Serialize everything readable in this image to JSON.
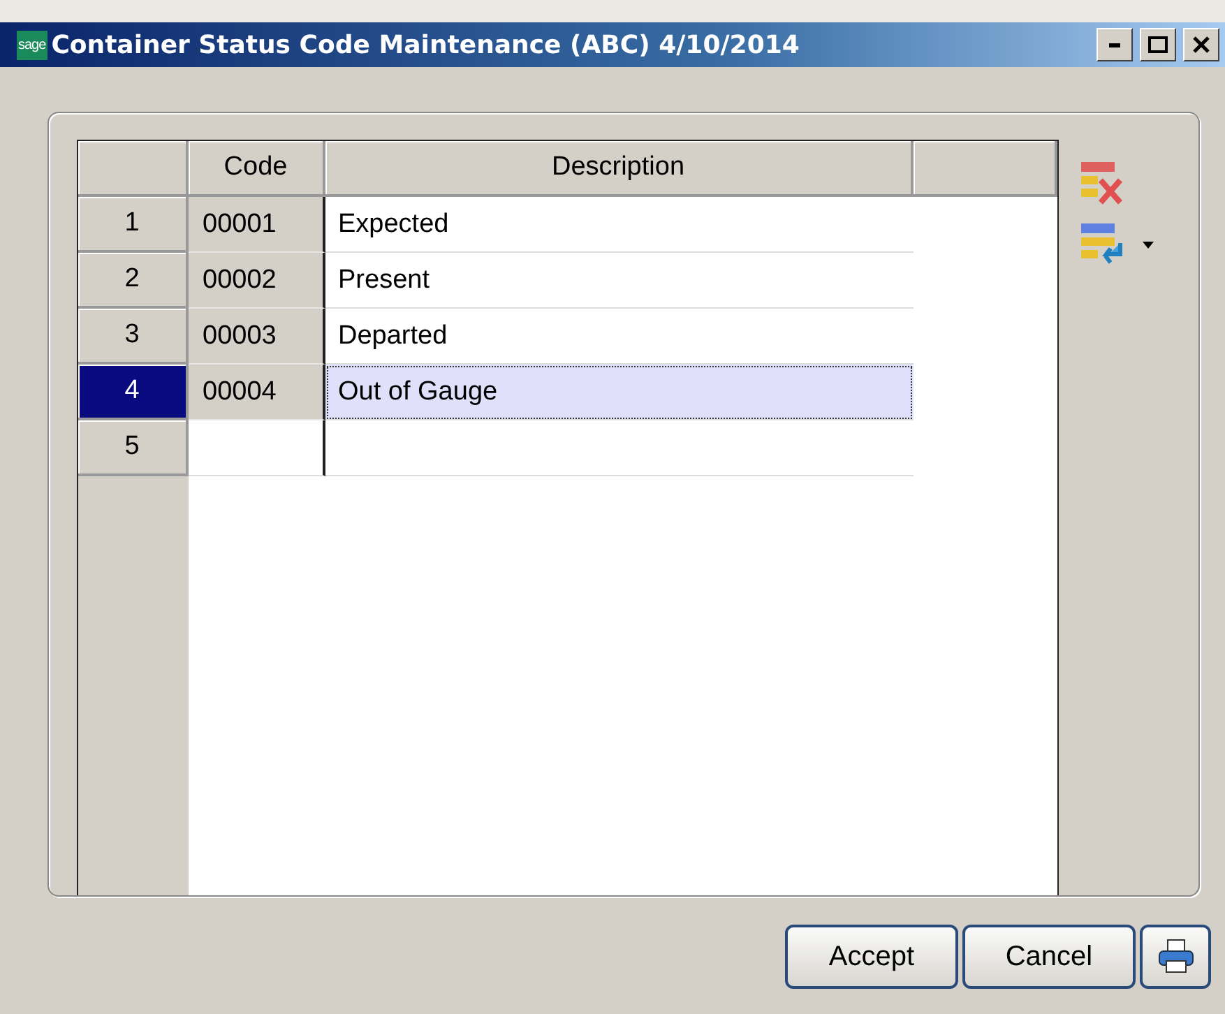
{
  "window": {
    "title": "Container Status Code Maintenance (ABC) 4/10/2014",
    "logo": "sage"
  },
  "grid": {
    "columns": [
      "Code",
      "Description"
    ],
    "rows": [
      {
        "number": "1",
        "code": "00001",
        "description": "Expected",
        "selected": false
      },
      {
        "number": "2",
        "code": "00002",
        "description": "Present",
        "selected": false
      },
      {
        "number": "3",
        "code": "00003",
        "description": "Departed",
        "selected": false
      },
      {
        "number": "4",
        "code": "00004",
        "description": "Out of Gauge",
        "selected": true
      },
      {
        "number": "5",
        "selected": false
      }
    ]
  },
  "buttons": [
    {
      "label": "Accept",
      "kind": "text"
    },
    {
      "label": "Cancel",
      "kind": "text"
    },
    {
      "kind": "print"
    }
  ]
}
